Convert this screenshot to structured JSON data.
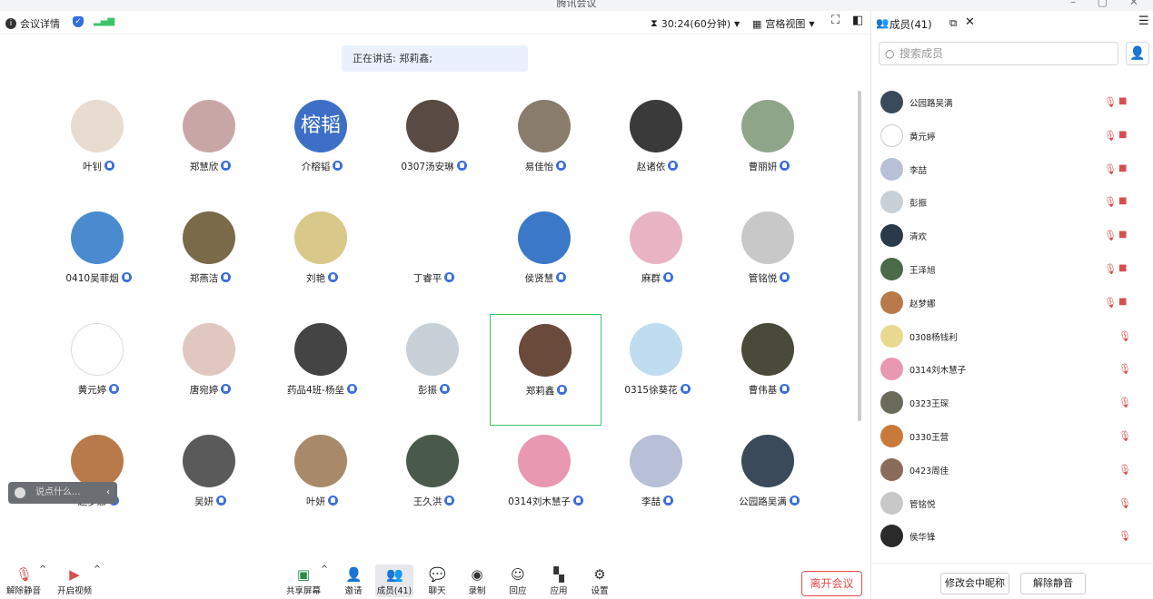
{
  "window": {
    "title": "腾讯会议",
    "controls": "– ▢ ✕"
  },
  "topbar": {
    "meeting_details": "会议详情",
    "timer": "30:24(60分钟)",
    "view_mode": "宫格视图"
  },
  "speaking": "正在讲话: 郑莉鑫;",
  "participants": [
    {
      "name": "叶钊",
      "color": "#e8dcd0"
    },
    {
      "name": "郑慧欣",
      "color": "#c9a6a6"
    },
    {
      "name": "介榕韬",
      "color": "#3e6fc6",
      "initial": "榕韬"
    },
    {
      "name": "0307汤安琳",
      "color": "#5a4a44"
    },
    {
      "name": "易佳怡",
      "color": "#8a7c6c"
    },
    {
      "name": "赵诸依",
      "color": "#3a3a3a"
    },
    {
      "name": "曹丽妍",
      "color": "#8fa58a"
    },
    {
      "name": "0410吴菲烟",
      "color": "#4a8bd0"
    },
    {
      "name": "郑燕洁",
      "color": "#7a6a4a"
    },
    {
      "name": "刘艳",
      "color": "#d8c88a"
    },
    {
      "name": "丁睿平",
      "color": ""
    },
    {
      "name": "侯贤慧",
      "color": "#3c78c8"
    },
    {
      "name": "麻群",
      "color": "#e8b4c4"
    },
    {
      "name": "管铭悦",
      "color": "#c8c8c8"
    },
    {
      "name": "黄元婷",
      "color": "#ffffff"
    },
    {
      "name": "唐宛婷",
      "color": "#e0c8c0"
    },
    {
      "name": "药品4班-杨垒",
      "color": "#444444"
    },
    {
      "name": "彭振",
      "color": "#c8d0d8"
    },
    {
      "name": "郑莉鑫",
      "color": "#6a4a3a"
    },
    {
      "name": "0315徐葵花",
      "color": "#c0dcf0"
    },
    {
      "name": "曹伟基",
      "color": "#4a4a3a"
    },
    {
      "name": "赵梦娜",
      "color": "#b87a4a"
    },
    {
      "name": "吴妍",
      "color": "#5a5a5a"
    },
    {
      "name": "叶妍",
      "color": "#a88a6a"
    },
    {
      "name": "王久洪",
      "color": "#4a5a4a"
    },
    {
      "name": "0314刘木慧子",
      "color": "#e898b0"
    },
    {
      "name": "李喆",
      "color": "#b8c0d8"
    },
    {
      "name": "公园路吴满",
      "color": "#3a4a5a"
    }
  ],
  "chat_placeholder": "说点什么...",
  "bottombar": {
    "mute": "解除静音",
    "video": "开启视频",
    "share": "共享屏幕",
    "invite": "邀请",
    "members": "成员(41)",
    "chat": "聊天",
    "record": "录制",
    "react": "回应",
    "apps": "应用",
    "settings": "设置",
    "leave": "离开会议"
  },
  "panel": {
    "title": "成员(41)",
    "search_placeholder": "搜索成员",
    "members": [
      {
        "name": "公园路吴满",
        "color": "#3a4a5a",
        "cam": true
      },
      {
        "name": "黄元婷",
        "color": "#ffffff",
        "cam": true
      },
      {
        "name": "李喆",
        "color": "#b8c0d8",
        "cam": true
      },
      {
        "name": "彭振",
        "color": "#c8d0d8",
        "cam": true
      },
      {
        "name": "清欢",
        "color": "#2a3a4a",
        "cam": true
      },
      {
        "name": "王泽旭",
        "color": "#4a6a4a",
        "cam": true
      },
      {
        "name": "赵梦娜",
        "color": "#b87a4a",
        "cam": true
      },
      {
        "name": "0308杨钱利",
        "color": "#e8d890",
        "cam": false
      },
      {
        "name": "0314刘木慧子",
        "color": "#e898b0",
        "cam": false
      },
      {
        "name": "0323王琛",
        "color": "#6a6a5a",
        "cam": false
      },
      {
        "name": "0330王营",
        "color": "#c87a3a",
        "cam": false
      },
      {
        "name": "0423周佳",
        "color": "#8a6a5a",
        "cam": false
      },
      {
        "name": "管铭悦",
        "color": "#c8c8c8",
        "cam": false
      },
      {
        "name": "侯华锋",
        "color": "#2a2a2a",
        "cam": false
      }
    ],
    "rename_button": "修改会中昵称",
    "unmute_button": "解除静音"
  }
}
